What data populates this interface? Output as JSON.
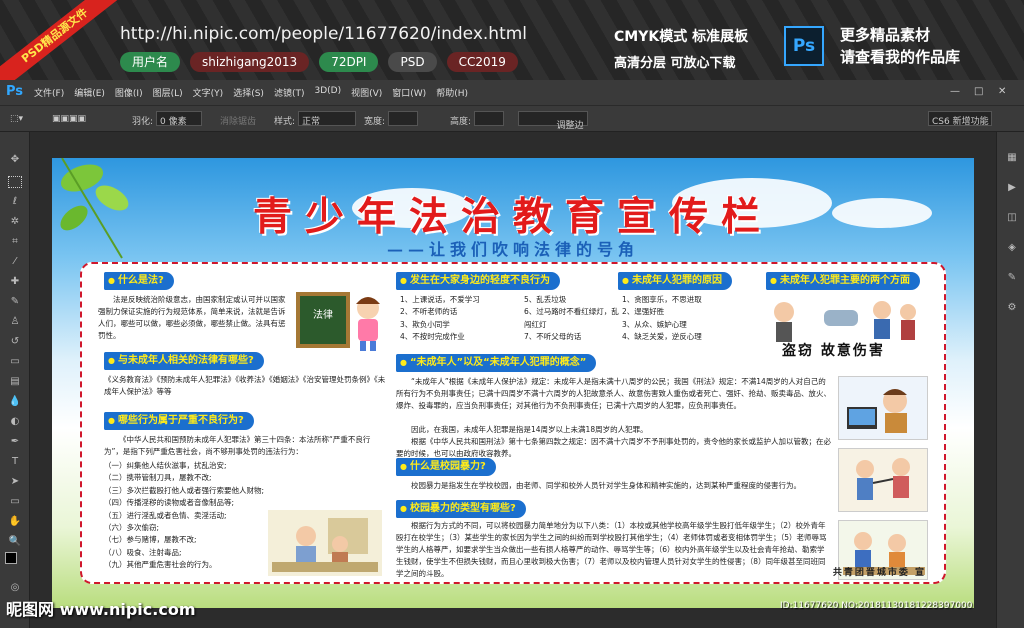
{
  "banner": {
    "ribbon": "PSD精品源文件",
    "url": "http://hi.nipic.com/people/11677620/index.html",
    "tags": [
      "用户名",
      "shizhigang2013",
      "72DPI",
      "PSD",
      "CC2019"
    ],
    "mode_line1": "CMYK模式 标准展板",
    "mode_line2": "高清分层 可放心下载",
    "ps_icon": "Ps",
    "more_line1": "更多精品素材",
    "more_line2": "请查看我的作品库"
  },
  "menubar": {
    "logo": "Ps",
    "items": [
      "文件(F)",
      "编辑(E)",
      "图像(I)",
      "图层(L)",
      "文字(Y)",
      "选择(S)",
      "滤镜(T)",
      "3D(D)",
      "视图(V)",
      "窗口(W)",
      "帮助(H)"
    ]
  },
  "options": {
    "feather_label": "羽化:",
    "feather_value": "0 像素",
    "antialias": "消除锯齿",
    "style_label": "样式:",
    "style_value": "正常",
    "width_label": "宽度:",
    "height_label": "高度:",
    "refine": "调整边缘...",
    "workspace": "CS6 新增功能"
  },
  "poster": {
    "title": "青少年法治教育宣传栏",
    "subtitle": "——让我们吹响法律的号角",
    "s1": {
      "head": "什么是法?",
      "body": "法是反映统治阶级意志，由国家制定或认可并以国家强制力保证实施的行为规范体系，简单来说，法就是告诉人们，哪些可以做，哪些必须做，哪些禁止做。法具有惩罚性。",
      "board": "法律"
    },
    "s2": {
      "head": "与未成年人相关的法律有哪些?",
      "body": "《义务教育法》《预防未成年人犯罪法》《收养法》《婚姻法》《治安管理处罚条例》《未成年人保护法》等等"
    },
    "s3": {
      "head": "哪些行为属于严重不良行为?",
      "intro": "《中华人民共和国预防未成年人犯罪法》第三十四条：本法所称“严重不良行为”，是指下列严重危害社会，尚不够刑事处罚的违法行为：",
      "items": [
        "（一）纠集他人结伙滋事，扰乱治安;",
        "（二）携带管制刀具，屡教不改;",
        "（三）多次拦截殴打他人或者强行索要他人财物;",
        "（四）传播淫秽的读物或者音像制品等;",
        "（五）进行淫乱或者色情、卖淫活动;",
        "（六）多次偷窃;",
        "（七）参与赌博，屡教不改;",
        "（八）吸食、注射毒品;",
        "（九）其他严重危害社会的行为。"
      ]
    },
    "s4": {
      "head": "发生在大家身边的轻度不良行为",
      "col1": [
        "1、上课说话，不爱学习",
        "2、不听老师的话",
        "3、欺负小同学",
        "4、不按时完成作业"
      ],
      "col2": [
        "5、乱丢垃圾",
        "6、过马路时不看红绿灯，乱闯红灯",
        "7、不听父母的话"
      ]
    },
    "s5": {
      "head": "未成年人犯罪的原因",
      "items": [
        "1、贪图享乐，不思进取",
        "2、逞强好胜",
        "3、从众、嫉妒心理",
        "4、缺乏关爱，逆反心理"
      ]
    },
    "s6": {
      "head": "未成年人犯罪主要的两个方面",
      "caption": "盗窃 故意伤害"
    },
    "s7": {
      "head": "“未成年人”以及“未成年人犯罪的概念”",
      "p1": "“未成年人”根据《未成年人保护法》规定：未成年人是指未满十八周岁的公民；我国《刑法》规定：不满14周岁的人对自己的所有行为不负刑事责任；已满十四周岁不满十六周岁的人犯故意杀人、故意伤害致人重伤或者死亡、强奸、抢劫、贩卖毒品、放火、爆炸、投毒罪的，应当负刑事责任；对其他行为不负刑事责任；已满十六周岁的人犯罪，应负刑事责任。",
      "p2": "因此，在我国，未成年人犯罪是指是14周岁以上未满18周岁的人犯罪。",
      "p3": "根据《中华人民共和国刑法》第十七条第四款之规定：因不满十六周岁不予刑事处罚的，责令他的家长或监护人加以管教；在必要的时候，也可以由政府收容教养。"
    },
    "s8": {
      "head": "什么是校园暴力?",
      "body": "校园暴力是指发生在学校校园，由老师、同学和校外人员针对学生身体和精神实施的，达到某种严重程度的侵害行为。"
    },
    "s9": {
      "head": "校园暴力的类型有哪些?",
      "body": "根据行为方式的不同，可以将校园暴力简单地分为以下八类：（1）本校或其他学校高年级学生殴打低年级学生；（2）校外青年殴打在校学生；（3）某些学生的家长因为学生之间的纠纷而到学校殴打其他学生；（4）老师体罚或者变相体罚学生；（5）老师辱骂学生的人格尊严，如要求学生当众做出一些有损人格尊严的动作、辱骂学生等；（6）校内外高年级学生以及社会青年抢劫、勒索学生钱财，使学生不但损失钱财，而且心里收到极大伤害；（7）老师以及校内管理人员针对女学生的性侵害；（8）同年级甚至同班同学之间的斗殴。"
    },
    "sign": "共青团晋城市委 宣"
  },
  "watermark": {
    "left": "昵图网 www.nipic.com",
    "right": "ID:11677620 NO:20181130181228397000"
  }
}
